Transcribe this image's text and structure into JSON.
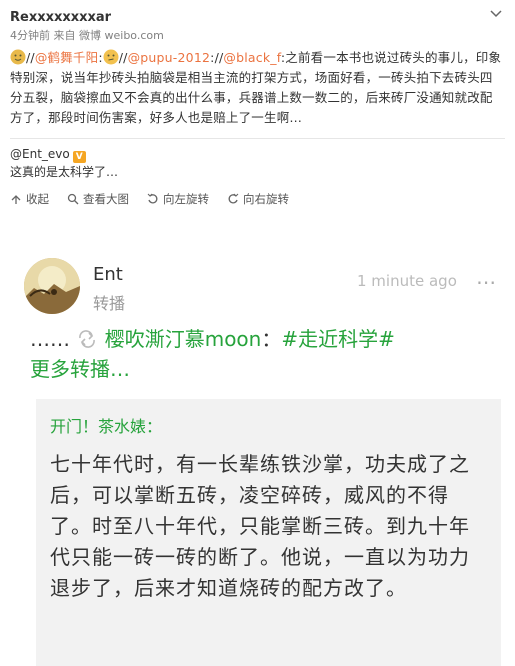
{
  "post": {
    "username": "Rexxxxxxxxar",
    "time": "4分钟前",
    "source_prefix": "来自",
    "source": "微博 weibo.com",
    "content": {
      "sep1": "//",
      "mention1": "@鹤舞千阳",
      "colon1": ":",
      "sep2": "//",
      "mention2": "@pupu-2012",
      "colon2": ":",
      "sep3": "//",
      "mention3": "@black_f",
      "text": ":之前看一本书也说过砖头的事儿，印象特别深，说当年抄砖头拍脑袋是相当主流的打架方式，场面好看，一砖头拍下去砖头四分五裂，脑袋擦血又不会真的出什么事，兵器谱上数一数二的，后来砖厂没通知就改配方了，那段时间伤害案，好多人也是赔上了一生啊…"
    },
    "emoji1": "doge-emoji",
    "emoji2": "thinking-emoji"
  },
  "repost": {
    "author": "@Ent_evo",
    "badge": "V",
    "text": "这真的是太科学了…"
  },
  "toolbar": {
    "collapse": "收起",
    "view_large": "查看大图",
    "rotate_left": "向左旋转",
    "rotate_right": "向右旋转"
  },
  "image": {
    "name": "Ent",
    "sub": "转播",
    "ago": "1 minute ago",
    "chain_prefix": "……",
    "chain_user": "樱吹澌汀慕moon",
    "chain_colon": "：",
    "chain_tag": "#走近科学#",
    "chain_more": "更多转播…",
    "quote_title": "开门！茶水婊：",
    "quote_body": "七十年代时，有一长辈练铁沙掌，功夫成了之后，可以掌断五砖，凌空碎砖，威风的不得了。时至八十年代，只能掌断三砖。到九十年代只能一砖一砖的断了。他说，一直以为功力退步了，后来才知道烧砖的配方改了。"
  },
  "colors": {
    "link": "#eb7340",
    "green": "#27a33c",
    "badge": "#f5a623"
  }
}
